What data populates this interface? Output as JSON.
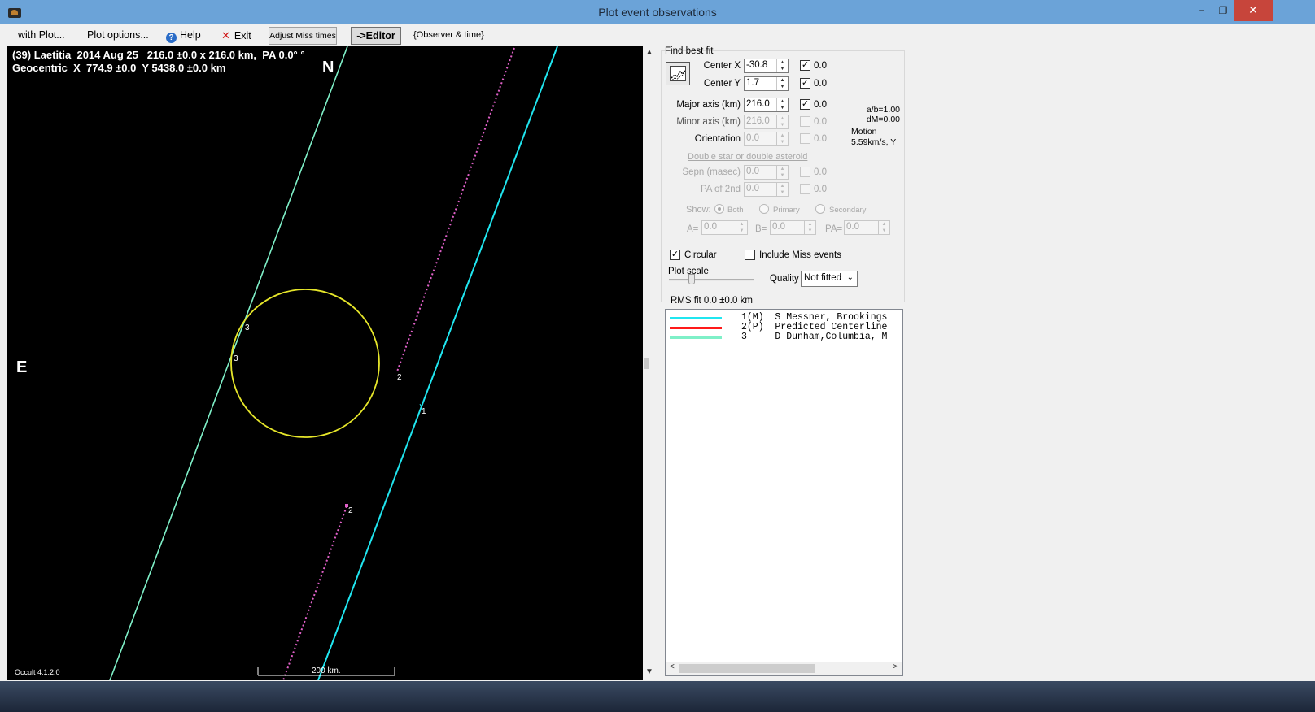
{
  "window": {
    "title": "Plot event observations",
    "minimize_glyph": "–",
    "restore_glyph": "❐",
    "close_glyph": "✕",
    "app_icon": "occult-app-icon"
  },
  "menu": {
    "with_plot": "with Plot...",
    "plot_options": "Plot options...",
    "help": "Help",
    "exit": "Exit",
    "adjust_miss": "Adjust Miss times",
    "editor": "->Editor",
    "observer_time": "{Observer & time}"
  },
  "plot": {
    "header_line1": "(39) Laetitia  2014 Aug 25   216.0 ±0.0 x 216.0 km,  PA 0.0° °",
    "header_line2": "Geocentric  X  774.9 ±0.0  Y 5438.0 ±0.0 km",
    "north": "N",
    "east": "E",
    "version": "Occult 4.1.2.0",
    "scale_label": "200 km.",
    "chord_labels": [
      "3",
      "3",
      "2",
      "1",
      "2"
    ],
    "colors": {
      "background": "#000000",
      "ellipse": "#e6e62a",
      "chord_dunham": "#7ff0c8",
      "chord_messner": "#20e6f0",
      "chord_predicted": "#e060c8"
    }
  },
  "fit": {
    "group_title": "Find best fit",
    "center_x": {
      "label": "Center X",
      "value": "-30.8",
      "weight": "0.0",
      "checked": true
    },
    "center_y": {
      "label": "Center Y",
      "value": "1.7",
      "weight": "0.0",
      "checked": true
    },
    "major_axis": {
      "label": "Major axis (km)",
      "value": "216.0",
      "weight": "0.0",
      "checked": true
    },
    "minor_axis": {
      "label": "Minor axis (km)",
      "value": "216.0",
      "weight": "0.0",
      "checked": false
    },
    "orientation": {
      "label": "Orientation",
      "value": "0.0",
      "weight": "0.0",
      "checked": false
    },
    "ratio": "a/b=1.00",
    "dm": "dM=0.00",
    "motion_label": "Motion",
    "motion_value": "5.59km/s, Y",
    "double_title": "Double star  or  double asteroid",
    "sepn": {
      "label": "Sepn (masec)",
      "value": "0.0",
      "weight": "0.0"
    },
    "pa_2nd": {
      "label": "PA of 2nd",
      "value": "0.0",
      "weight": "0.0"
    },
    "show_label": "Show:",
    "show_both": "Both",
    "show_primary": "Primary",
    "show_secondary": "Secondary",
    "a_label": "A=",
    "a_value": "0.0",
    "b_label": "B=",
    "b_value": "0.0",
    "pa_label": "PA=",
    "pa_value": "0.0",
    "circular": "Circular",
    "circular_checked": true,
    "include_miss": "Include Miss events",
    "include_miss_checked": false,
    "plot_scale": "Plot scale",
    "quality_label": "Quality",
    "quality_value": "Not fitted",
    "rms": "RMS fit 0.0 ±0.0 km"
  },
  "observers": [
    {
      "text": "1(M)  S Messner, Brookings",
      "color": "#20e6f0"
    },
    {
      "text": "2(P)  Predicted Centerline",
      "color": "#ff1a1a"
    },
    {
      "text": "3     D Dunham,Columbia, M",
      "color": "#7ff0c8"
    }
  ],
  "scroll": {
    "up": "▲",
    "down": "▼",
    "left": "<",
    "right": ">"
  }
}
